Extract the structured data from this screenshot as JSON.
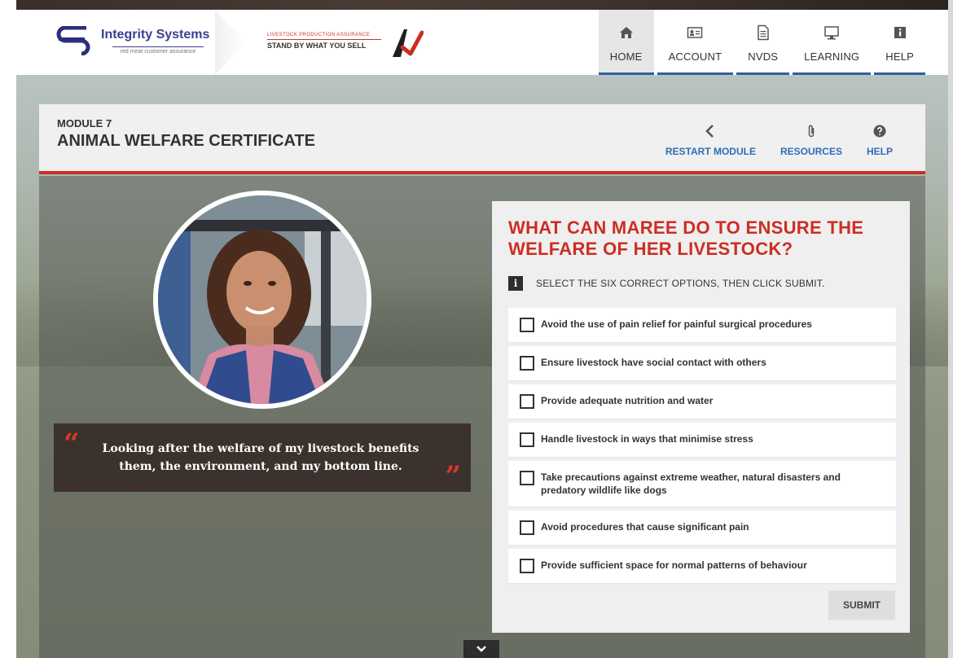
{
  "brand": {
    "name": "Integrity Systems",
    "tagline": "red meat customer assurance",
    "lpa_line1": "LIVESTOCK PRODUCTION ASSURANCE",
    "lpa_line2": "STAND BY WHAT YOU SELL"
  },
  "nav": {
    "items": [
      {
        "label": "HOME",
        "icon": "home-icon",
        "active": true
      },
      {
        "label": "ACCOUNT",
        "icon": "id-card-icon"
      },
      {
        "label": "NVDS",
        "icon": "document-icon"
      },
      {
        "label": "LEARNING",
        "icon": "monitor-icon"
      },
      {
        "label": "HELP",
        "icon": "info-icon"
      }
    ],
    "accent_color": "#2f5fa0"
  },
  "module": {
    "number": "MODULE 7",
    "title": "ANIMAL WELFARE CERTIFICATE",
    "actions": [
      {
        "label": "RESTART MODULE",
        "icon": "chevron-left-icon"
      },
      {
        "label": "RESOURCES",
        "icon": "paperclip-icon"
      },
      {
        "label": "HELP",
        "icon": "question-circle-icon"
      }
    ],
    "accent_color": "#cc2e22"
  },
  "quote": {
    "text": "Looking after the welfare of my livestock benefits them, the environment, and my bottom line."
  },
  "question": {
    "title": "WHAT CAN MAREE DO TO ENSURE THE WELFARE OF HER LIVESTOCK?",
    "instruction": "SELECT THE SIX CORRECT OPTIONS, THEN CLICK SUBMIT.",
    "options": [
      {
        "label": "Avoid the use of pain relief for painful surgical procedures",
        "checked": false
      },
      {
        "label": "Ensure livestock have social contact with others",
        "checked": false
      },
      {
        "label": "Provide adequate nutrition and water",
        "checked": false
      },
      {
        "label": "Handle livestock in ways that minimise stress",
        "checked": false
      },
      {
        "label": "Take precautions against extreme weather, natural disasters and predatory wildlife like dogs",
        "checked": false
      },
      {
        "label": "Avoid procedures that cause significant pain",
        "checked": false
      },
      {
        "label": "Provide sufficient space for normal patterns of behaviour",
        "checked": false
      }
    ],
    "submit_label": "SUBMIT"
  }
}
